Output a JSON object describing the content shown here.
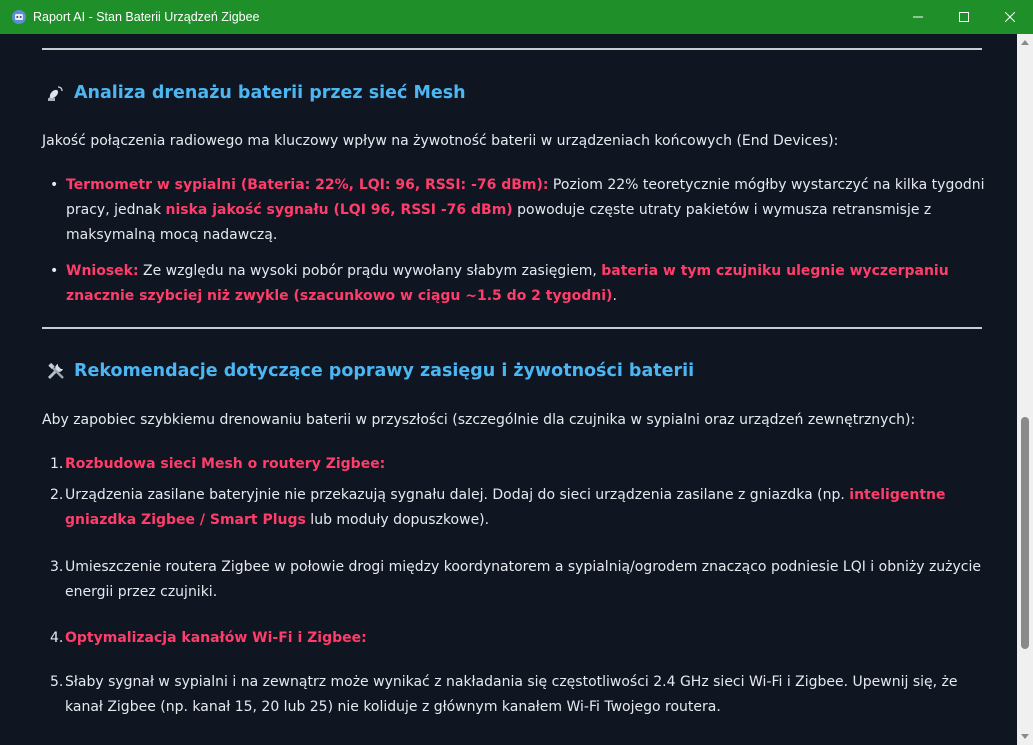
{
  "window": {
    "title": "Raport AI - Stan Baterii Urządzeń Zigbee",
    "titlebar_color": "#1f8f2a",
    "icons": [
      "app-icon",
      "minimize-icon",
      "maximize-icon",
      "close-icon"
    ]
  },
  "section1": {
    "heading": "Analiza drenażu baterii przez sieć Mesh",
    "icon": "satellite-dish-icon",
    "intro": "Jakość połączenia radiowego ma kluczowy wpływ na żywotność baterii w urządzeniach końcowych (End Devices):",
    "bullets": [
      {
        "highlight": "Termometr w sypialni (Bateria: 22%, LQI: 96, RSSI: -76 dBm):",
        "text1": " Poziom 22% teoretycznie mógłby wystarczyć na kilka tygodni pracy, jednak ",
        "highlight2": "niska jakość sygnału (LQI 96, RSSI -76 dBm)",
        "text2": " powoduje częste utraty pakietów i wymusza retransmisje z maksymalną mocą nadawczą."
      },
      {
        "highlight": "Wniosek:",
        "text1": " Ze względu na wysoki pobór prądu wywołany słabym zasięgiem, ",
        "highlight2": "bateria w tym czujniku ulegnie wyczerpaniu znacznie szybciej niż zwykle (szacunkowo w ciągu ~1.5 do 2 tygodni)",
        "text2": "."
      }
    ]
  },
  "section2": {
    "heading": "Rekomendacje dotyczące poprawy zasięgu i żywotności baterii",
    "icon": "tools-icon",
    "intro": "Aby zapobiec szybkiemu drenowaniu baterii w przyszłości (szczególnie dla czujnika w sypialni oraz urządzeń zewnętrznych):",
    "items": [
      {
        "num": "1.",
        "highlight": "Rozbudowa sieci Mesh o routery Zigbee:",
        "text1": "",
        "highlight2": "",
        "text2": ""
      },
      {
        "num": "2.",
        "highlight": "",
        "text1": "Urządzenia zasilane bateryjnie nie przekazują sygnału dalej. Dodaj do sieci urządzenia zasilane z gniazdka (np. ",
        "highlight2": "inteligentne gniazdka Zigbee / Smart Plugs",
        "text2": " lub moduły dopuszkowe)."
      },
      {
        "num": "3.",
        "highlight": "",
        "text1": "Umieszczenie routera Zigbee w połowie drogi między koordynatorem a sypialnią/ogrodem znacząco podniesie LQI i obniży zużycie energii przez czujniki.",
        "highlight2": "",
        "text2": ""
      },
      {
        "num": "4.",
        "highlight": "Optymalizacja kanałów Wi-Fi i Zigbee:",
        "text1": "",
        "highlight2": "",
        "text2": ""
      },
      {
        "num": "5.",
        "highlight": "",
        "text1": "Słaby sygnał w sypialni i na zewnątrz może wynikać z nakładania się częstotliwości 2.4 GHz sieci Wi-Fi i Zigbee. Upewnij się, że kanał Zigbee (np. kanał 15, 20 lub 25) nie koliduje z głównym kanałem Wi-Fi Twojego routera.",
        "highlight2": "",
        "text2": ""
      }
    ]
  },
  "colors": {
    "background": "#0f1521",
    "heading": "#4cb6f2",
    "highlight": "#ff3d6a",
    "text": "#e6e9ee"
  }
}
